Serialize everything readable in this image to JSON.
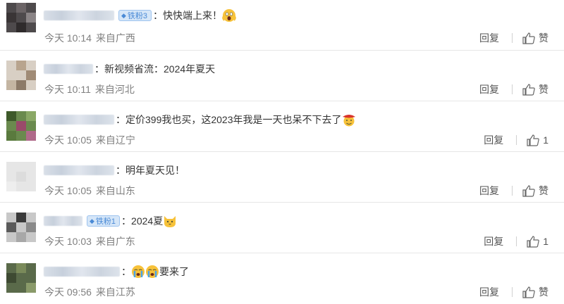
{
  "actions": {
    "reply_label": "回复",
    "like_label": "赞"
  },
  "colors": {
    "badge_text": "#4a8ad6",
    "badge_bg": "#d5e6f8",
    "meta": "#808080"
  },
  "comments": [
    {
      "badge": "铁粉3",
      "text": "：快快端上来！",
      "emoji": "screaming-face-icon",
      "time": "今天 10:14",
      "location": "来自广西",
      "likes": "赞"
    },
    {
      "badge": "",
      "text": "：新视频省流：2024年夏天",
      "emoji": "",
      "time": "今天 10:11",
      "location": "来自河北",
      "likes": "赞"
    },
    {
      "badge": "",
      "text": "：定价399我也买，这2023年我是一天也呆不下去了",
      "emoji": "cowboy-face-icon",
      "time": "今天 10:05",
      "location": "来自辽宁",
      "likes": "1"
    },
    {
      "badge": "",
      "text": "：明年夏天见！",
      "emoji": "",
      "time": "今天 10:05",
      "location": "来自山东",
      "likes": "赞"
    },
    {
      "badge": "铁粉1",
      "text": "：2024夏",
      "emoji": "cat-face-icon",
      "time": "今天 10:03",
      "location": "来自广东",
      "likes": "1"
    },
    {
      "badge": "",
      "text": "要来了",
      "emoji": "crying-face-icon",
      "time": "今天 09:56",
      "location": "来自江苏",
      "likes": "赞"
    }
  ]
}
